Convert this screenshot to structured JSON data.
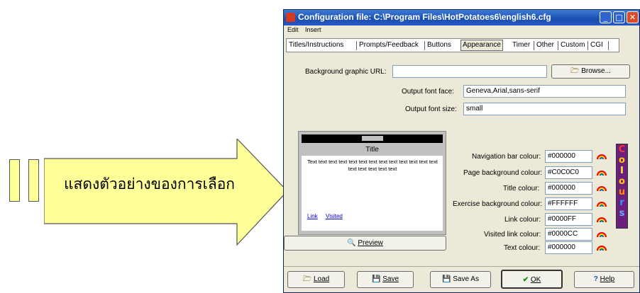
{
  "annotation": {
    "text": "แสดงตัวอย่างของการเลือก"
  },
  "window": {
    "title": "Configuration file: C:\\Program Files\\HotPotatoes6\\english6.cfg",
    "menu": [
      "Edit",
      "Insert"
    ],
    "tabs": [
      "Titles/Instructions",
      "Prompts/Feedback",
      "Buttons",
      "Appearance",
      "Timer",
      "Other",
      "Custom",
      "CGI"
    ],
    "active_tab": "Appearance"
  },
  "appearance": {
    "background_url_label": "Background graphic URL:",
    "background_url_value": "",
    "browse_label": "Browse...",
    "font_face_label": "Output font face:",
    "font_face_value": "Geneva,Arial,sans-serif",
    "font_size_label": "Output font size:",
    "font_size_value": "small"
  },
  "preview": {
    "title": "Title",
    "body_text": "Text text text text text text text text text text text text text text text text text text",
    "link": "Link",
    "visited": "Visited",
    "button_label": "Preview"
  },
  "colours": [
    {
      "label": "Navigation bar colour:",
      "value": "#000000"
    },
    {
      "label": "Page background colour:",
      "value": "#C0C0C0"
    },
    {
      "label": "Title colour:",
      "value": "#000000"
    },
    {
      "label": "Exercise background colour:",
      "value": "#FFFFFF"
    },
    {
      "label": "Link colour:",
      "value": "#0000FF"
    },
    {
      "label": "Visited link colour:",
      "value": "#0000CC"
    },
    {
      "label": "Text colour:",
      "value": "#000000"
    }
  ],
  "colours_button_letters": [
    "C",
    "o",
    "l",
    "o",
    "u",
    "r",
    "s"
  ],
  "footer": {
    "load": "Load",
    "save": "Save",
    "save_as": "Save As",
    "ok": "OK",
    "help": "Help"
  },
  "palette": {
    "window_bg": "#ece9d8",
    "titlebar": "#1a4fb0",
    "arrow_fill": "#ffff99"
  }
}
